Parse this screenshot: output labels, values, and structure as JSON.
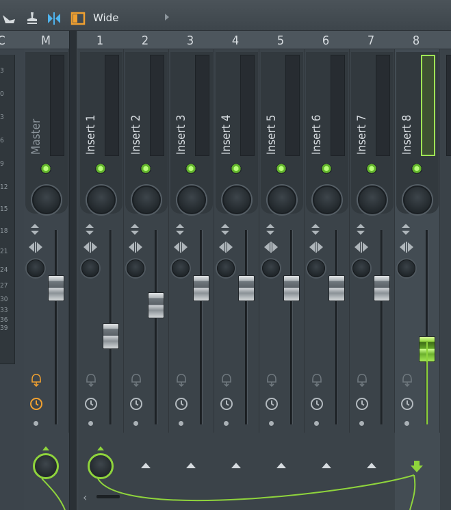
{
  "toolbar": {
    "buttons": [
      "pointer-tool-icon",
      "stamp-tool-icon",
      "mirror-icon",
      "layout-icon"
    ],
    "mode_label": "Wide",
    "accent_color": "#f0a030"
  },
  "header": {
    "partial_label": "C",
    "master_label": "M",
    "insert_numbers": [
      "1",
      "2",
      "3",
      "4",
      "5",
      "6",
      "7",
      "8"
    ]
  },
  "scale": {
    "ticks": [
      "3",
      "0",
      "3",
      "6",
      "9",
      "12",
      "15",
      "18",
      "21",
      "24",
      "27",
      "30",
      "33",
      "36",
      "39"
    ]
  },
  "strips": [
    {
      "label": "Master",
      "fader": 0.68,
      "selected": false,
      "send": "knob",
      "master": true
    },
    {
      "label": "Insert 1",
      "fader": 0.34,
      "selected": false,
      "send": "knob"
    },
    {
      "label": "Insert 2",
      "fader": 0.56,
      "selected": false,
      "send": "arrow"
    },
    {
      "label": "Insert 3",
      "fader": 0.68,
      "selected": false,
      "send": "arrow"
    },
    {
      "label": "Insert 4",
      "fader": 0.68,
      "selected": false,
      "send": "arrow"
    },
    {
      "label": "Insert 5",
      "fader": 0.68,
      "selected": false,
      "send": "arrow"
    },
    {
      "label": "Insert 6",
      "fader": 0.68,
      "selected": false,
      "send": "arrow"
    },
    {
      "label": "Insert 7",
      "fader": 0.68,
      "selected": false,
      "send": "arrow"
    },
    {
      "label": "Insert 8",
      "fader": 0.25,
      "selected": true,
      "send": "target"
    }
  ],
  "colors": {
    "green": "#8fd43c",
    "orange": "#f0a030",
    "panel": "#3c444b"
  }
}
